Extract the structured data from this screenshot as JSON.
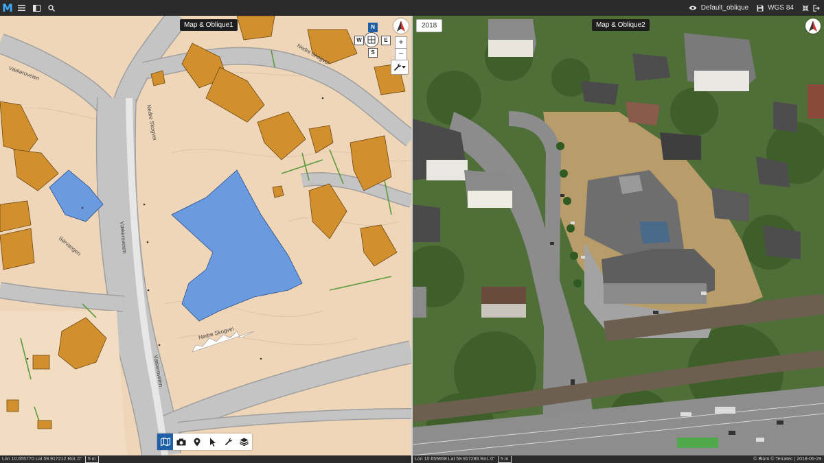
{
  "toolbar": {
    "logo": "M",
    "style_name": "Default_oblique",
    "crs_label": "WGS 84"
  },
  "left_view": {
    "title": "Map & Oblique1",
    "nav": {
      "n": "N",
      "w": "W",
      "e": "E",
      "s": "S"
    },
    "zoom_in": "+",
    "zoom_out": "−",
    "street_labels": {
      "vaekeroveien_top": "Vækeroveien",
      "nedre_skogvei_top": "Nedre Skogvei",
      "nedre_skogvei_mid": "Nedre Skogvei",
      "vaekeroveien_mid": "Vækeroveien",
      "sorvangen": "Sørvangen",
      "nedre_skogvei_bottom": "Nedre Skogvei",
      "vaekeroveien_bottom": "Vækeroveien"
    },
    "status": {
      "coords": "Lon 10.655770 Lat 59.917212 Rot.:0°",
      "scale": "5 m"
    }
  },
  "right_view": {
    "title": "Map & Oblique2",
    "year": "2018",
    "status": {
      "coords": "Lon 10.655658 Lat 59.917289 Rot.:0°",
      "scale": "5 m"
    },
    "copyright": "© Blom © Terratec | 2018-06-29"
  },
  "colors": {
    "background_map": "#efd6b8",
    "road": "#bdbdbd",
    "building": "#d18f2d",
    "highlight_building": "#6a9be0",
    "active": "#1f5fa8"
  }
}
